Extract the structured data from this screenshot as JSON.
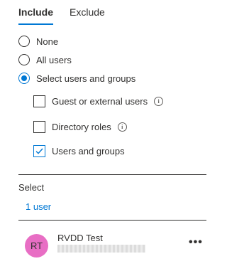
{
  "tabs": [
    {
      "label": "Include",
      "active": true
    },
    {
      "label": "Exclude",
      "active": false
    }
  ],
  "options": [
    {
      "label": "None",
      "selected": false
    },
    {
      "label": "All users",
      "selected": false
    },
    {
      "label": "Select users and groups",
      "selected": true
    }
  ],
  "checks": [
    {
      "label": "Guest or external users",
      "checked": false,
      "info": true
    },
    {
      "label": "Directory roles",
      "checked": false,
      "info": true
    },
    {
      "label": "Users and groups",
      "checked": true,
      "info": false
    }
  ],
  "select": {
    "title": "Select",
    "count": "1 user"
  },
  "users": [
    {
      "initials": "RT",
      "name": "RVDD Test",
      "more": "•••"
    }
  ],
  "icons": {
    "info": "ⓘ",
    "checkmark": "check-icon"
  },
  "colors": {
    "accent": "#0078d4",
    "avatar": "#e86ec4"
  }
}
